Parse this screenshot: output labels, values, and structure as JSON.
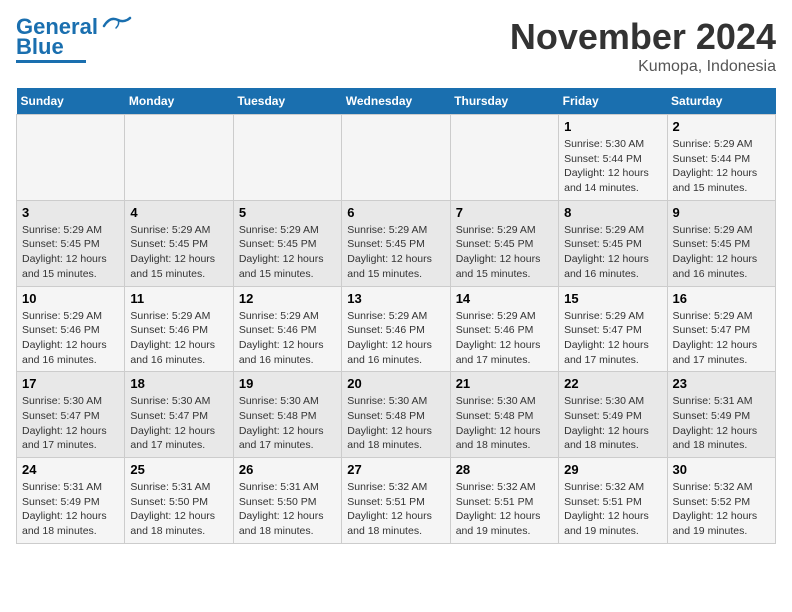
{
  "logo": {
    "line1": "General",
    "line2": "Blue"
  },
  "header": {
    "month_year": "November 2024",
    "location": "Kumopa, Indonesia"
  },
  "weekdays": [
    "Sunday",
    "Monday",
    "Tuesday",
    "Wednesday",
    "Thursday",
    "Friday",
    "Saturday"
  ],
  "weeks": [
    [
      {
        "day": "",
        "info": ""
      },
      {
        "day": "",
        "info": ""
      },
      {
        "day": "",
        "info": ""
      },
      {
        "day": "",
        "info": ""
      },
      {
        "day": "",
        "info": ""
      },
      {
        "day": "1",
        "info": "Sunrise: 5:30 AM\nSunset: 5:44 PM\nDaylight: 12 hours\nand 14 minutes."
      },
      {
        "day": "2",
        "info": "Sunrise: 5:29 AM\nSunset: 5:44 PM\nDaylight: 12 hours\nand 15 minutes."
      }
    ],
    [
      {
        "day": "3",
        "info": "Sunrise: 5:29 AM\nSunset: 5:45 PM\nDaylight: 12 hours\nand 15 minutes."
      },
      {
        "day": "4",
        "info": "Sunrise: 5:29 AM\nSunset: 5:45 PM\nDaylight: 12 hours\nand 15 minutes."
      },
      {
        "day": "5",
        "info": "Sunrise: 5:29 AM\nSunset: 5:45 PM\nDaylight: 12 hours\nand 15 minutes."
      },
      {
        "day": "6",
        "info": "Sunrise: 5:29 AM\nSunset: 5:45 PM\nDaylight: 12 hours\nand 15 minutes."
      },
      {
        "day": "7",
        "info": "Sunrise: 5:29 AM\nSunset: 5:45 PM\nDaylight: 12 hours\nand 15 minutes."
      },
      {
        "day": "8",
        "info": "Sunrise: 5:29 AM\nSunset: 5:45 PM\nDaylight: 12 hours\nand 16 minutes."
      },
      {
        "day": "9",
        "info": "Sunrise: 5:29 AM\nSunset: 5:45 PM\nDaylight: 12 hours\nand 16 minutes."
      }
    ],
    [
      {
        "day": "10",
        "info": "Sunrise: 5:29 AM\nSunset: 5:46 PM\nDaylight: 12 hours\nand 16 minutes."
      },
      {
        "day": "11",
        "info": "Sunrise: 5:29 AM\nSunset: 5:46 PM\nDaylight: 12 hours\nand 16 minutes."
      },
      {
        "day": "12",
        "info": "Sunrise: 5:29 AM\nSunset: 5:46 PM\nDaylight: 12 hours\nand 16 minutes."
      },
      {
        "day": "13",
        "info": "Sunrise: 5:29 AM\nSunset: 5:46 PM\nDaylight: 12 hours\nand 16 minutes."
      },
      {
        "day": "14",
        "info": "Sunrise: 5:29 AM\nSunset: 5:46 PM\nDaylight: 12 hours\nand 17 minutes."
      },
      {
        "day": "15",
        "info": "Sunrise: 5:29 AM\nSunset: 5:47 PM\nDaylight: 12 hours\nand 17 minutes."
      },
      {
        "day": "16",
        "info": "Sunrise: 5:29 AM\nSunset: 5:47 PM\nDaylight: 12 hours\nand 17 minutes."
      }
    ],
    [
      {
        "day": "17",
        "info": "Sunrise: 5:30 AM\nSunset: 5:47 PM\nDaylight: 12 hours\nand 17 minutes."
      },
      {
        "day": "18",
        "info": "Sunrise: 5:30 AM\nSunset: 5:47 PM\nDaylight: 12 hours\nand 17 minutes."
      },
      {
        "day": "19",
        "info": "Sunrise: 5:30 AM\nSunset: 5:48 PM\nDaylight: 12 hours\nand 17 minutes."
      },
      {
        "day": "20",
        "info": "Sunrise: 5:30 AM\nSunset: 5:48 PM\nDaylight: 12 hours\nand 18 minutes."
      },
      {
        "day": "21",
        "info": "Sunrise: 5:30 AM\nSunset: 5:48 PM\nDaylight: 12 hours\nand 18 minutes."
      },
      {
        "day": "22",
        "info": "Sunrise: 5:30 AM\nSunset: 5:49 PM\nDaylight: 12 hours\nand 18 minutes."
      },
      {
        "day": "23",
        "info": "Sunrise: 5:31 AM\nSunset: 5:49 PM\nDaylight: 12 hours\nand 18 minutes."
      }
    ],
    [
      {
        "day": "24",
        "info": "Sunrise: 5:31 AM\nSunset: 5:49 PM\nDaylight: 12 hours\nand 18 minutes."
      },
      {
        "day": "25",
        "info": "Sunrise: 5:31 AM\nSunset: 5:50 PM\nDaylight: 12 hours\nand 18 minutes."
      },
      {
        "day": "26",
        "info": "Sunrise: 5:31 AM\nSunset: 5:50 PM\nDaylight: 12 hours\nand 18 minutes."
      },
      {
        "day": "27",
        "info": "Sunrise: 5:32 AM\nSunset: 5:51 PM\nDaylight: 12 hours\nand 18 minutes."
      },
      {
        "day": "28",
        "info": "Sunrise: 5:32 AM\nSunset: 5:51 PM\nDaylight: 12 hours\nand 19 minutes."
      },
      {
        "day": "29",
        "info": "Sunrise: 5:32 AM\nSunset: 5:51 PM\nDaylight: 12 hours\nand 19 minutes."
      },
      {
        "day": "30",
        "info": "Sunrise: 5:32 AM\nSunset: 5:52 PM\nDaylight: 12 hours\nand 19 minutes."
      }
    ]
  ]
}
